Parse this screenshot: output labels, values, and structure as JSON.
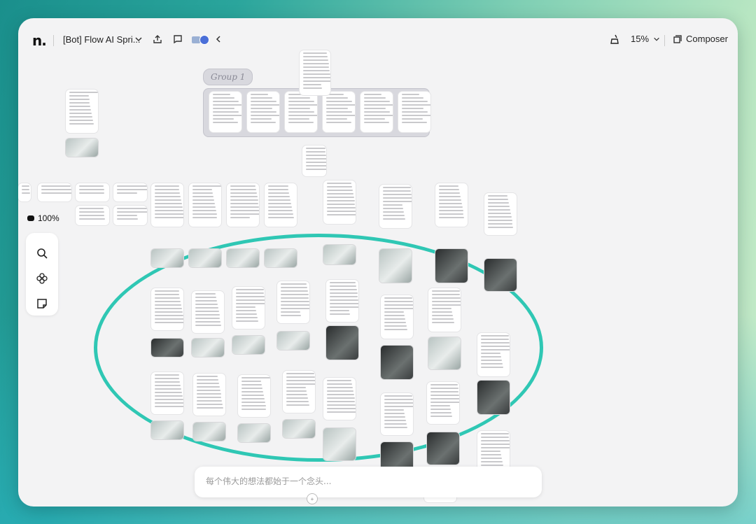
{
  "app": {
    "logo_text": "n.",
    "document_title": "[Bot] Flow AI Spri...",
    "zoom_level": "15%",
    "composer_label": "Composer",
    "mini_zoom": "100%"
  },
  "group": {
    "label": "Group 1"
  },
  "prompt": {
    "placeholder": "每个伟大的想法都始于一个念头..."
  },
  "icons": {
    "chevron": "chevron-down-icon",
    "share": "share-icon",
    "comment": "comment-icon",
    "collapse": "chevron-left-icon",
    "clean": "broom-icon",
    "composer": "composer-icon",
    "search": "search-icon",
    "flower": "flower-icon",
    "sticky": "sticky-note-icon"
  },
  "colors": {
    "highlight_ellipse": "#2fc7b4",
    "canvas_bg": "#f3f3f4"
  }
}
